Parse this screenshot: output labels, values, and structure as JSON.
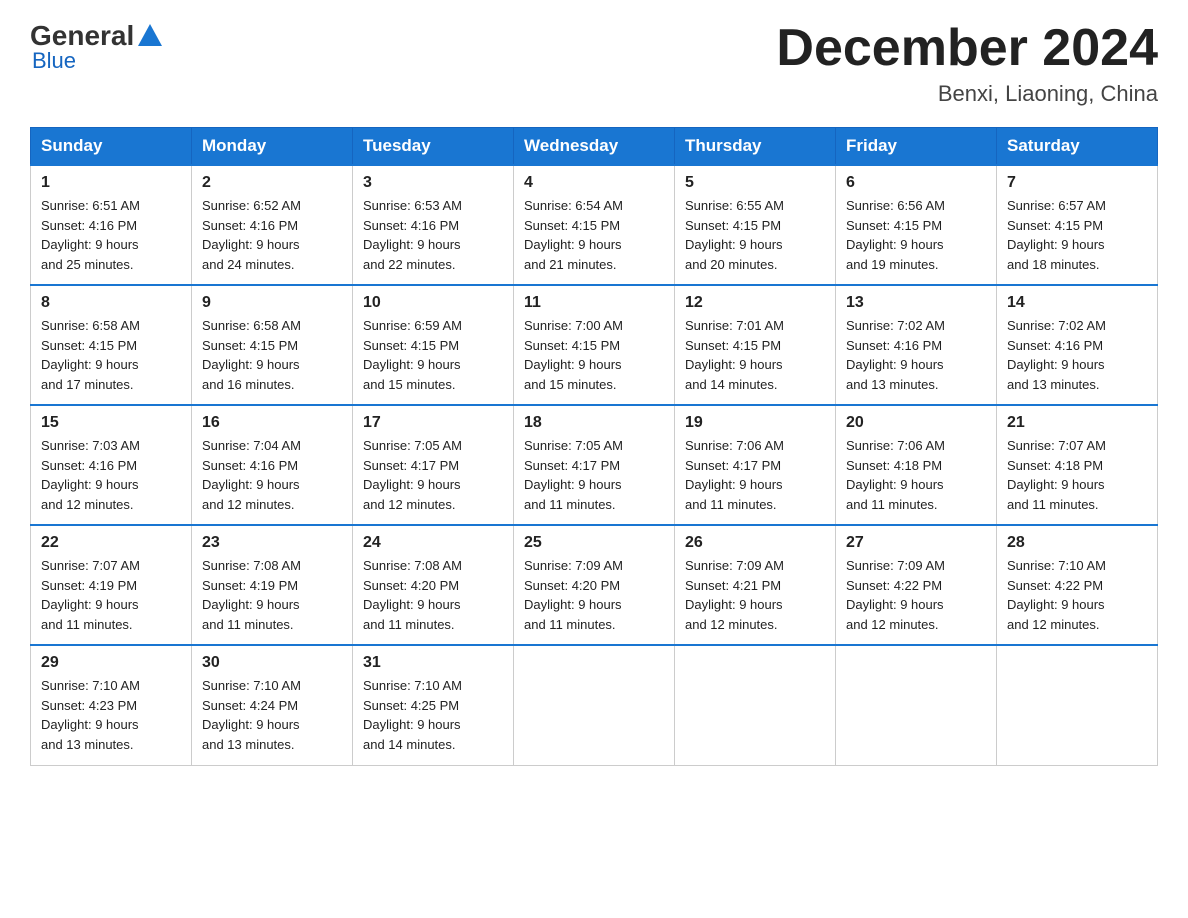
{
  "logo": {
    "general": "General",
    "blue": "Blue"
  },
  "title": {
    "month": "December 2024",
    "location": "Benxi, Liaoning, China"
  },
  "headers": [
    "Sunday",
    "Monday",
    "Tuesday",
    "Wednesday",
    "Thursday",
    "Friday",
    "Saturday"
  ],
  "weeks": [
    [
      {
        "day": "1",
        "sunrise": "6:51 AM",
        "sunset": "4:16 PM",
        "daylight": "9 hours and 25 minutes."
      },
      {
        "day": "2",
        "sunrise": "6:52 AM",
        "sunset": "4:16 PM",
        "daylight": "9 hours and 24 minutes."
      },
      {
        "day": "3",
        "sunrise": "6:53 AM",
        "sunset": "4:16 PM",
        "daylight": "9 hours and 22 minutes."
      },
      {
        "day": "4",
        "sunrise": "6:54 AM",
        "sunset": "4:15 PM",
        "daylight": "9 hours and 21 minutes."
      },
      {
        "day": "5",
        "sunrise": "6:55 AM",
        "sunset": "4:15 PM",
        "daylight": "9 hours and 20 minutes."
      },
      {
        "day": "6",
        "sunrise": "6:56 AM",
        "sunset": "4:15 PM",
        "daylight": "9 hours and 19 minutes."
      },
      {
        "day": "7",
        "sunrise": "6:57 AM",
        "sunset": "4:15 PM",
        "daylight": "9 hours and 18 minutes."
      }
    ],
    [
      {
        "day": "8",
        "sunrise": "6:58 AM",
        "sunset": "4:15 PM",
        "daylight": "9 hours and 17 minutes."
      },
      {
        "day": "9",
        "sunrise": "6:58 AM",
        "sunset": "4:15 PM",
        "daylight": "9 hours and 16 minutes."
      },
      {
        "day": "10",
        "sunrise": "6:59 AM",
        "sunset": "4:15 PM",
        "daylight": "9 hours and 15 minutes."
      },
      {
        "day": "11",
        "sunrise": "7:00 AM",
        "sunset": "4:15 PM",
        "daylight": "9 hours and 15 minutes."
      },
      {
        "day": "12",
        "sunrise": "7:01 AM",
        "sunset": "4:15 PM",
        "daylight": "9 hours and 14 minutes."
      },
      {
        "day": "13",
        "sunrise": "7:02 AM",
        "sunset": "4:16 PM",
        "daylight": "9 hours and 13 minutes."
      },
      {
        "day": "14",
        "sunrise": "7:02 AM",
        "sunset": "4:16 PM",
        "daylight": "9 hours and 13 minutes."
      }
    ],
    [
      {
        "day": "15",
        "sunrise": "7:03 AM",
        "sunset": "4:16 PM",
        "daylight": "9 hours and 12 minutes."
      },
      {
        "day": "16",
        "sunrise": "7:04 AM",
        "sunset": "4:16 PM",
        "daylight": "9 hours and 12 minutes."
      },
      {
        "day": "17",
        "sunrise": "7:05 AM",
        "sunset": "4:17 PM",
        "daylight": "9 hours and 12 minutes."
      },
      {
        "day": "18",
        "sunrise": "7:05 AM",
        "sunset": "4:17 PM",
        "daylight": "9 hours and 11 minutes."
      },
      {
        "day": "19",
        "sunrise": "7:06 AM",
        "sunset": "4:17 PM",
        "daylight": "9 hours and 11 minutes."
      },
      {
        "day": "20",
        "sunrise": "7:06 AM",
        "sunset": "4:18 PM",
        "daylight": "9 hours and 11 minutes."
      },
      {
        "day": "21",
        "sunrise": "7:07 AM",
        "sunset": "4:18 PM",
        "daylight": "9 hours and 11 minutes."
      }
    ],
    [
      {
        "day": "22",
        "sunrise": "7:07 AM",
        "sunset": "4:19 PM",
        "daylight": "9 hours and 11 minutes."
      },
      {
        "day": "23",
        "sunrise": "7:08 AM",
        "sunset": "4:19 PM",
        "daylight": "9 hours and 11 minutes."
      },
      {
        "day": "24",
        "sunrise": "7:08 AM",
        "sunset": "4:20 PM",
        "daylight": "9 hours and 11 minutes."
      },
      {
        "day": "25",
        "sunrise": "7:09 AM",
        "sunset": "4:20 PM",
        "daylight": "9 hours and 11 minutes."
      },
      {
        "day": "26",
        "sunrise": "7:09 AM",
        "sunset": "4:21 PM",
        "daylight": "9 hours and 12 minutes."
      },
      {
        "day": "27",
        "sunrise": "7:09 AM",
        "sunset": "4:22 PM",
        "daylight": "9 hours and 12 minutes."
      },
      {
        "day": "28",
        "sunrise": "7:10 AM",
        "sunset": "4:22 PM",
        "daylight": "9 hours and 12 minutes."
      }
    ],
    [
      {
        "day": "29",
        "sunrise": "7:10 AM",
        "sunset": "4:23 PM",
        "daylight": "9 hours and 13 minutes."
      },
      {
        "day": "30",
        "sunrise": "7:10 AM",
        "sunset": "4:24 PM",
        "daylight": "9 hours and 13 minutes."
      },
      {
        "day": "31",
        "sunrise": "7:10 AM",
        "sunset": "4:25 PM",
        "daylight": "9 hours and 14 minutes."
      },
      null,
      null,
      null,
      null
    ]
  ],
  "labels": {
    "sunrise": "Sunrise:",
    "sunset": "Sunset:",
    "daylight": "Daylight:"
  }
}
